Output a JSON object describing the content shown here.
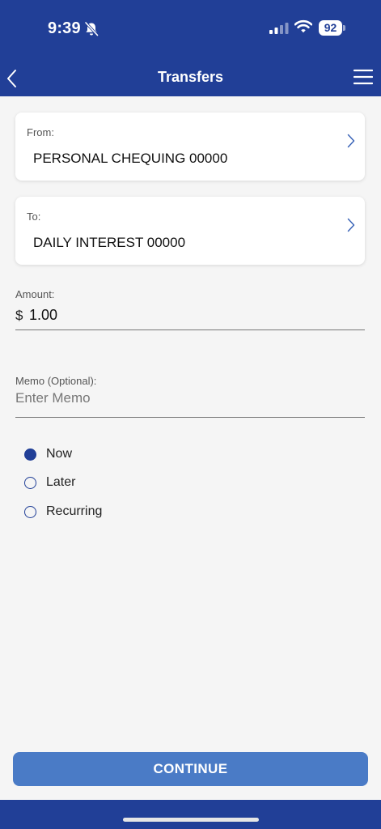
{
  "status_bar": {
    "time": "9:39",
    "battery": "92"
  },
  "header": {
    "title": "Transfers"
  },
  "from_card": {
    "label": "From:",
    "account": "PERSONAL CHEQUING 00000"
  },
  "to_card": {
    "label": "To:",
    "account": "DAILY INTEREST 00000"
  },
  "amount": {
    "label": "Amount:",
    "currency": "$",
    "value": "1.00"
  },
  "memo": {
    "label": "Memo (Optional):",
    "placeholder": "Enter Memo",
    "value": ""
  },
  "schedule": {
    "selected": "Now",
    "options": [
      {
        "label": "Now",
        "selected": true
      },
      {
        "label": "Later",
        "selected": false
      },
      {
        "label": "Recurring",
        "selected": false
      }
    ]
  },
  "continue_label": "CONTINUE",
  "colors": {
    "brand": "#213f97",
    "button": "#4a7bc6",
    "background": "#f5f5f5"
  },
  "icons": {
    "back": "chevron-left-icon",
    "menu": "hamburger-menu-icon",
    "card_chevron": "chevron-right-icon",
    "silent": "bell-slash-icon",
    "signal": "cellular-signal-icon",
    "wifi": "wifi-icon",
    "battery": "battery-icon"
  }
}
